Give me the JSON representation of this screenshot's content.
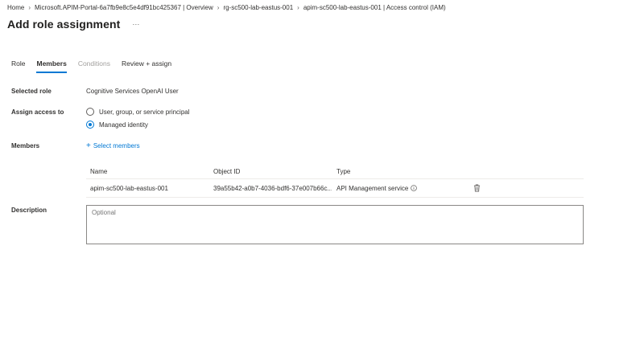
{
  "breadcrumb": {
    "items": [
      "Home",
      "Microsoft.APIM-Portal-6a7fb9e8c5e4df91bc425367 | Overview",
      "rg-sc500-lab-eastus-001",
      "apim-sc500-lab-eastus-001 | Access control (IAM)"
    ],
    "separator": "›"
  },
  "page": {
    "title": "Add role assignment",
    "more_label": "···"
  },
  "tabs": [
    {
      "label": "Role",
      "state": "normal"
    },
    {
      "label": "Members",
      "state": "active"
    },
    {
      "label": "Conditions",
      "state": "disabled"
    },
    {
      "label": "Review + assign",
      "state": "normal"
    }
  ],
  "form": {
    "selected_role_label": "Selected role",
    "selected_role_value": "Cognitive Services OpenAI User",
    "assign_access_label": "Assign access to",
    "assign_options": [
      {
        "label": "User, group, or service principal",
        "checked": false
      },
      {
        "label": "Managed identity",
        "checked": true
      }
    ],
    "members_label": "Members",
    "select_members_label": "Select members",
    "description_label": "Description",
    "description_placeholder": "Optional"
  },
  "members_table": {
    "columns": [
      "Name",
      "Object ID",
      "Type"
    ],
    "rows": [
      {
        "name": "apim-sc500-lab-eastus-001",
        "object_id": "39a55b42-a0b7-4036-bdf6-37e007b66c...",
        "type": "API Management service"
      }
    ]
  },
  "icons": {
    "info": "info-icon",
    "delete": "trash-icon",
    "add": "plus-icon"
  },
  "colors": {
    "accent": "#0078d4",
    "text": "#323130",
    "disabled": "#a19f9d"
  }
}
